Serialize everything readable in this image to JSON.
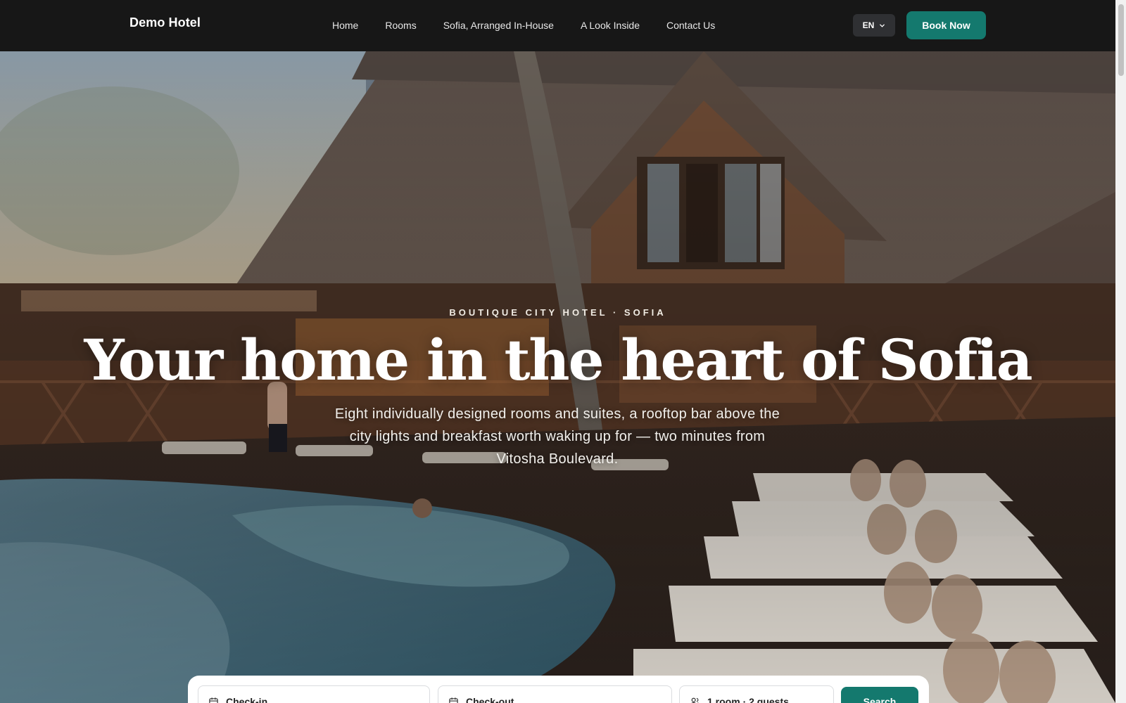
{
  "header": {
    "brand": "Demo Hotel",
    "nav": [
      "Home",
      "Rooms",
      "Sofia, Arranged In-House",
      "A Look Inside",
      "Contact Us"
    ],
    "language": "EN",
    "book_label": "Book Now"
  },
  "hero": {
    "eyebrow": "BOUTIQUE CITY HOTEL · SOFIA",
    "headline": "Your home in the heart of Sofia",
    "subtitle": "Eight individually designed rooms and suites, a rooftop bar above the city lights and breakfast worth waking up for — two minutes from Vitosha Boulevard."
  },
  "booking": {
    "check_in_label": "Check-in",
    "check_out_label": "Check-out",
    "guests_label": "1 room · 2 guests",
    "search_label": "Search"
  },
  "colors": {
    "accent": "#14796e",
    "header_bg": "#171717"
  },
  "icons": {
    "lang_chevron": "chevron-down-icon",
    "check_in": "calendar-icon",
    "check_out": "calendar-icon",
    "guests": "users-icon"
  }
}
